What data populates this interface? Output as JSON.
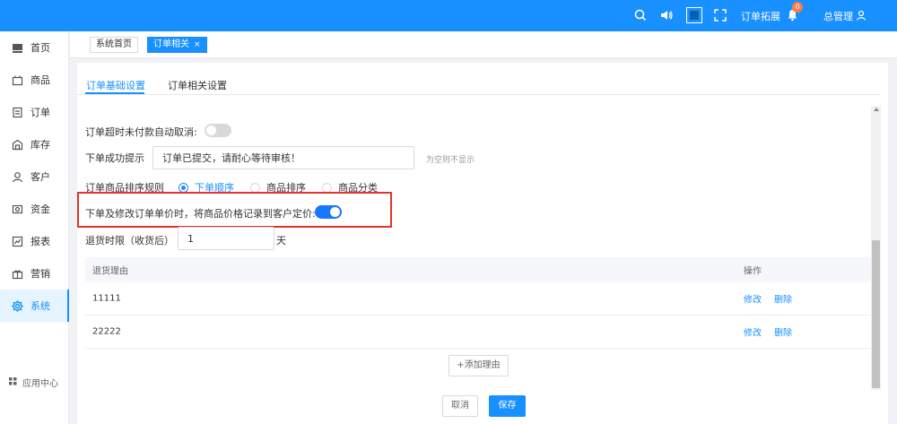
{
  "header": {
    "switch_system_label": "订单拓展",
    "notification_count": "0",
    "user_name": "总管理",
    "icons": [
      "search-icon",
      "volume-icon",
      "theme-icon",
      "fullscreen-icon",
      "bell-icon",
      "user-icon"
    ],
    "theme_color": "#1890ff"
  },
  "sidebar": {
    "items": [
      {
        "label": "首页",
        "icon": "home-icon"
      },
      {
        "label": "商品",
        "icon": "goods-icon"
      },
      {
        "label": "订单",
        "icon": "order-icon"
      },
      {
        "label": "库存",
        "icon": "inventory-icon"
      },
      {
        "label": "客户",
        "icon": "customer-icon"
      },
      {
        "label": "资金",
        "icon": "fund-icon"
      },
      {
        "label": "报表",
        "icon": "report-icon"
      },
      {
        "label": "营销",
        "icon": "marketing-icon"
      },
      {
        "label": "系统",
        "icon": "system-icon"
      }
    ],
    "active_index": 8,
    "bottom_label": "应用中心"
  },
  "page_tabs": [
    {
      "label": "系统首页"
    },
    {
      "label": "订单相关",
      "close": "×"
    }
  ],
  "settings": {
    "subtabs": [
      "订单基础设置",
      "订单相关设置"
    ],
    "timeout_cancel_label": "订单超时未付款自动取消:",
    "success_tip_label": "下单成功提示",
    "success_tip_value": "订单已提交，请耐心等待审核！",
    "success_tip_hint": "为空则不显示",
    "sort_rule_label": "订单商品排序规则",
    "sort_options": [
      "下单顺序",
      "商品排序",
      "商品分类"
    ],
    "sort_selected_index": 0,
    "reprice_label": "下单及修改订单单价时，将商品价格记录到客户定价:",
    "reprice_enabled": true,
    "timeout_cancel_enabled": false,
    "return_period_label": "退货时限（收货后）",
    "return_period_value": "1",
    "return_period_unit": "天"
  },
  "table": {
    "headers": [
      "退货理由",
      "操作"
    ],
    "rows": [
      {
        "reason": "11111",
        "edit": "修改",
        "delete": "删除"
      },
      {
        "reason": "22222",
        "edit": "修改",
        "delete": "删除"
      }
    ],
    "add_button": "+添加理由"
  },
  "footer": {
    "cancel": "取消",
    "save": "保存"
  },
  "colors": {
    "primary": "#1890ff",
    "highlight_border": "#e0352b"
  }
}
